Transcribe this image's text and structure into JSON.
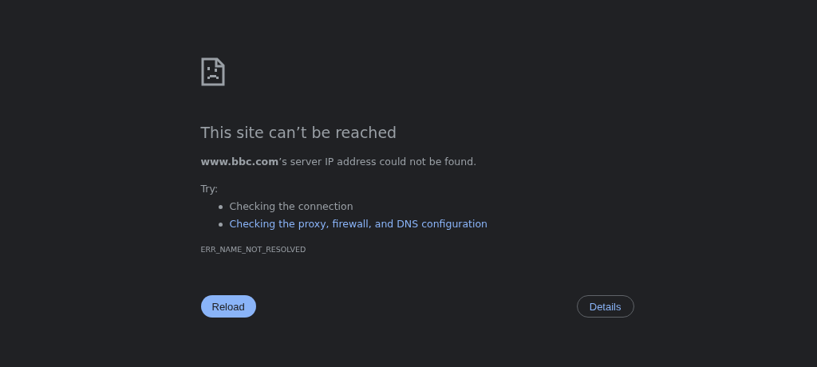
{
  "heading": "This site can’t be reached",
  "message": "**www.bbc.com**’s server IP address could not be found.",
  "try_label": "Try:",
  "suggestions": [
    {
      "kind": "text",
      "text": "Checking the connection"
    },
    {
      "kind": "link",
      "text": "Checking the proxy, firewall, and DNS configuration"
    }
  ],
  "error_code": "ERR_NAME_NOT_RESOLVED",
  "buttons": {
    "reload": "Reload",
    "details": "Details"
  }
}
